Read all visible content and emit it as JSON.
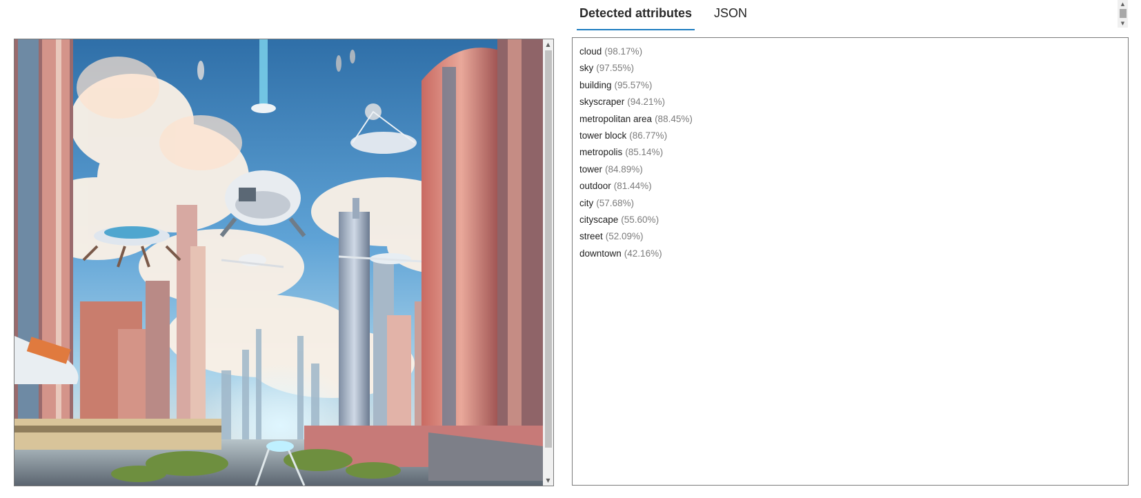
{
  "tabs": [
    {
      "label": "Detected attributes",
      "active": true
    },
    {
      "label": "JSON",
      "active": false
    }
  ],
  "image": {
    "description_icon": "futuristic-city-image"
  },
  "attributes": [
    {
      "name": "cloud",
      "score": "(98.17%)"
    },
    {
      "name": "sky",
      "score": "(97.55%)"
    },
    {
      "name": "building",
      "score": "(95.57%)"
    },
    {
      "name": "skyscraper",
      "score": "(94.21%)"
    },
    {
      "name": "metropolitan area",
      "score": "(88.45%)"
    },
    {
      "name": "tower block",
      "score": "(86.77%)"
    },
    {
      "name": "metropolis",
      "score": "(85.14%)"
    },
    {
      "name": "tower",
      "score": "(84.89%)"
    },
    {
      "name": "outdoor",
      "score": "(81.44%)"
    },
    {
      "name": "city",
      "score": "(57.68%)"
    },
    {
      "name": "cityscape",
      "score": "(55.60%)"
    },
    {
      "name": "street",
      "score": "(52.09%)"
    },
    {
      "name": "downtown",
      "score": "(42.16%)"
    }
  ],
  "colors": {
    "accent": "#1a7bbf",
    "score_text": "#7b7b7b"
  }
}
